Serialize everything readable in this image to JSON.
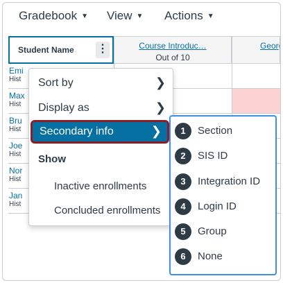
{
  "toolbar": {
    "gradebook": "Gradebook",
    "view": "View",
    "actions": "Actions",
    "caret_glyph": "▼"
  },
  "grid": {
    "student_header": "Student Name",
    "kebab_glyph": "⋮",
    "assignment_header": "Course Introduc…",
    "assignment_points": "Out of 10",
    "next_assignment_header": "Georg",
    "rows": [
      {
        "name": "Emi",
        "section": "Hist"
      },
      {
        "name": "Max",
        "section": "Hist"
      },
      {
        "name": "Bru",
        "section": "Hist"
      },
      {
        "name": "Joe",
        "section": "Hist"
      },
      {
        "name": "Nor",
        "section": "Hist"
      },
      {
        "name": "Jan",
        "section": "Hist"
      }
    ]
  },
  "menu": {
    "sort_by": "Sort by",
    "display_as": "Display as",
    "secondary_info": "Secondary info",
    "arrow_glyph": "❯",
    "show_heading": "Show",
    "inactive_enrollments": "Inactive enrollments",
    "concluded_enrollments": "Concluded enrollments"
  },
  "submenu": {
    "items": [
      {
        "num": "1",
        "label": "Section"
      },
      {
        "num": "2",
        "label": "SIS ID"
      },
      {
        "num": "3",
        "label": "Integration ID"
      },
      {
        "num": "4",
        "label": "Login ID"
      },
      {
        "num": "5",
        "label": "Group"
      },
      {
        "num": "6",
        "label": "None"
      }
    ]
  },
  "colors": {
    "accent": "#0770a3",
    "highlight_border": "#8b1d26",
    "submenu_border": "#3d8ee6",
    "missing_cell": "#fdd2d2"
  }
}
